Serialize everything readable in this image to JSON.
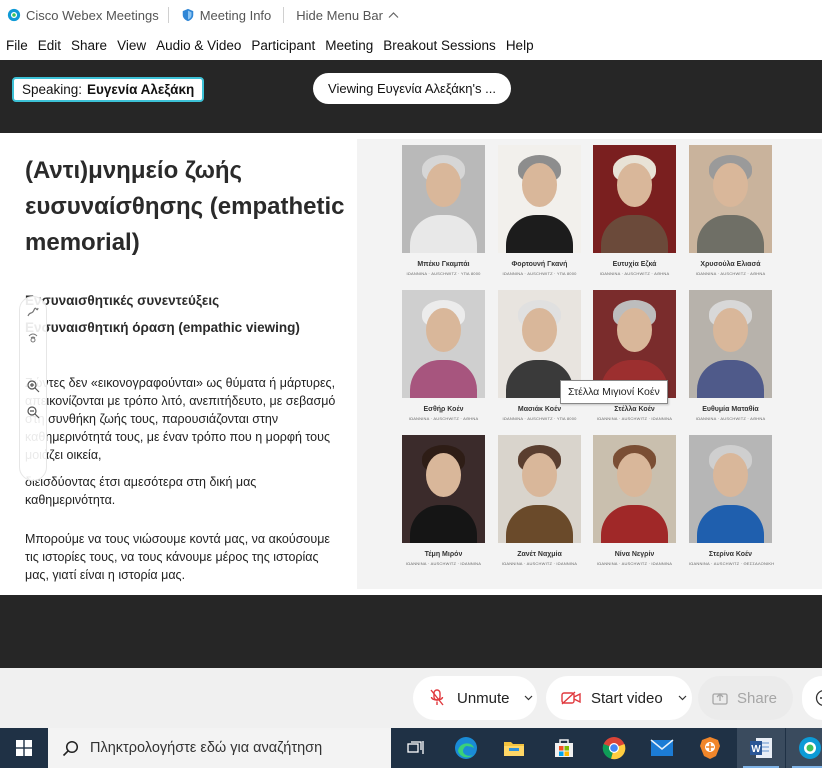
{
  "titlebar": {
    "app_name": "Cisco Webex Meetings",
    "meeting_info": "Meeting Info",
    "hide_menu_bar": "Hide Menu Bar"
  },
  "menu": [
    "File",
    "Edit",
    "Share",
    "View",
    "Audio & Video",
    "Participant",
    "Meeting",
    "Breakout Sessions",
    "Help"
  ],
  "meeting": {
    "speaking_label": "Speaking:",
    "speaking_name": "Ευγενία Αλεξάκη",
    "viewing_label": "Viewing Ευγενία Αλεξάκη's ..."
  },
  "slide": {
    "title": "(Αντι)μνημείο ζωής ευσυναίσθησης (empathetic memorial)",
    "subtitles": [
      "Ενσυναισθητικές συνεντεύξεις",
      "Ενσυναισθητική όραση (empathic viewing)"
    ],
    "paragraphs": [
      "Ζώντες δεν «εικονογραφούνται» ως θύματα ή μάρτυρες, απεικονίζονται με τρόπο λιτό, ανεπιτήδευτο, με σεβασμό στη συνθήκη ζωής τους, παρουσιάζονται στην καθημερινότητά τους, με έναν τρόπο που η μορφή τους μοιάζει οικεία,",
      "διεισδύοντας έτσι αμεσότερα στη δική μας καθημερινότητα.",
      "Μπορούμε να τους νιώσουμε κοντά μας, να ακούσουμε τις ιστορίες τους, να τους κάνουμε μέρος της ιστορίας μας, γιατί είναι η ιστορία μας."
    ],
    "tooltip": "Στέλλα Μιγιονί Κοέν",
    "portraits": [
      {
        "name": "Μπέκυ Γκαμπάι",
        "meta": "ΙΩΑΝΝΙΝΑ · AUSCHWITZ · ΥΠΑ 8000",
        "bg": "#b9b9b9",
        "hair": "#d6d6d6",
        "body": "#e8e8e8"
      },
      {
        "name": "Φορτουνή Γκανή",
        "meta": "ΙΩΑΝΝΙΝΑ · AUSCHWITZ · ΥΠΑ 8000",
        "bg": "#f2f0ec",
        "hair": "#8d8d8d",
        "body": "#1c1c1c"
      },
      {
        "name": "Ευτυχία Εζκά",
        "meta": "ΙΩΑΝΝΙΝΑ · AUSCHWITZ · ΑΘΗΝΑ",
        "bg": "#7a1f1f",
        "hair": "#e8e2d6",
        "body": "#6b4a3a"
      },
      {
        "name": "Χρυσούλα Ελιασά",
        "meta": "ΙΩΑΝΝΙΝΑ · AUSCHWITZ · ΑΘΗΝΑ",
        "bg": "#c9b39c",
        "hair": "#9a9a9a",
        "body": "#6f6f66"
      },
      {
        "name": "Εσθήρ Κοέν",
        "meta": "ΙΩΑΝΝΙΝΑ · AUSCHWITZ · ΑΘΗΝΑ",
        "bg": "#cfcfcf",
        "hair": "#ececec",
        "body": "#a7557e"
      },
      {
        "name": "Μασιάκ Κοέν",
        "meta": "ΙΩΑΝΝΙΝΑ · AUSCHWITZ · ΥΠΑ 8000",
        "bg": "#e8e4df",
        "hair": "#e0e0e0",
        "body": "#3a3a3a"
      },
      {
        "name": "Στέλλα Κοέν",
        "meta": "ΙΩΑΝΝΙΝΑ · AUSCHWITZ · ΙΩΑΝΝΙΝΑ",
        "bg": "#7a2c2c",
        "hair": "#bdbdbd",
        "body": "#9c2f2f"
      },
      {
        "name": "Ευθυμία Ματαθία",
        "meta": "ΙΩΑΝΝΙΝΑ · AUSCHWITZ · ΑΘΗΝΑ",
        "bg": "#b7b2ab",
        "hair": "#d8d8d8",
        "body": "#4f5a8a"
      },
      {
        "name": "Τέμη Μιρόν",
        "meta": "ΙΩΑΝΝΙΝΑ · AUSCHWITZ · ΙΩΑΝΝΙΝΑ",
        "bg": "#3b2b2b",
        "hair": "#2e1d16",
        "body": "#151515"
      },
      {
        "name": "Ζανέτ Ναχμία",
        "meta": "ΙΩΑΝΝΙΝΑ · AUSCHWITZ · ΙΩΑΝΝΙΝΑ",
        "bg": "#d9d4cc",
        "hair": "#5a3e2f",
        "body": "#6a4a2a"
      },
      {
        "name": "Νίνα Νεγρίν",
        "meta": "ΙΩΑΝΝΙΝΑ · AUSCHWITZ · ΙΩΑΝΝΙΝΑ",
        "bg": "#c9bfae",
        "hair": "#7a4e34",
        "body": "#a02828"
      },
      {
        "name": "Στερίνα Κοέν",
        "meta": "ΙΩΑΝΝΙΝΑ · AUSCHWITZ · ΘΕΣΣΑΛΟΝΙΚΗ",
        "bg": "#b6b6b6",
        "hair": "#cfcfcf",
        "body": "#1f5fae"
      }
    ]
  },
  "controls": {
    "unmute": "Unmute",
    "start_video": "Start video",
    "share": "Share"
  },
  "taskbar": {
    "search_placeholder": "Πληκτρολογήστε εδώ για αναζήτηση",
    "apps": [
      "task-view-icon",
      "edge-icon",
      "file-explorer-icon",
      "store-icon",
      "chrome-icon",
      "mail-icon",
      "brave-icon",
      "word-icon",
      "webex-icon"
    ]
  },
  "colors": {
    "meeting_bg": "#262626",
    "speaking_border": "#3cc1d6",
    "mute_red": "#e0393e",
    "taskbar_bg": "#1f3145"
  }
}
